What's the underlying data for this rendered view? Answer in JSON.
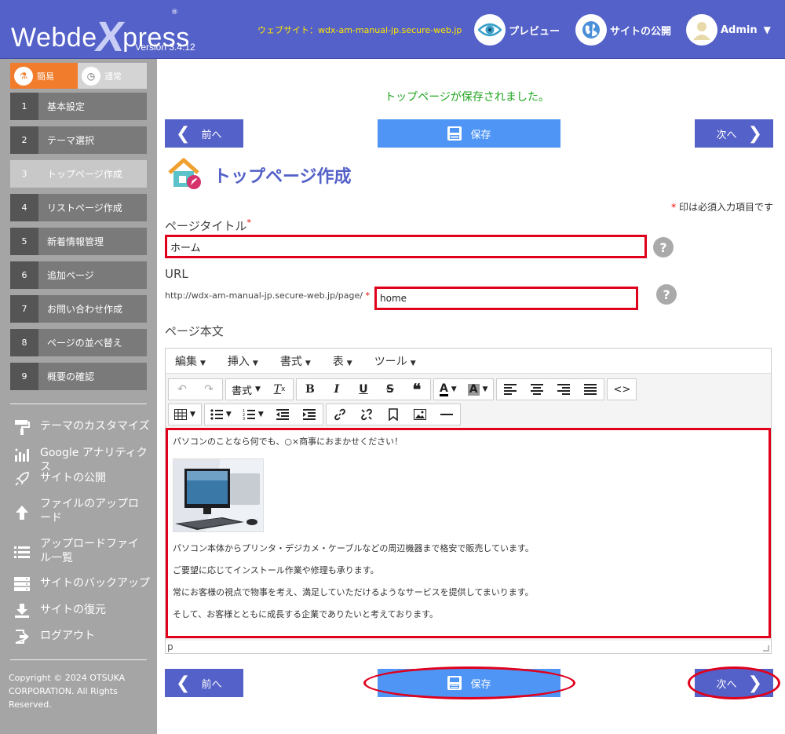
{
  "header": {
    "logo": {
      "part1": "Webde",
      "part2": "X",
      "part3": "press"
    },
    "version": "Version 3.4.12",
    "website": "ウェブサイト：wdx-am-manual-jp.secure-web.jp",
    "preview_label": "プレビュー",
    "publish_label": "サイトの公開",
    "admin_label": "Admin"
  },
  "sidebar": {
    "modes": [
      {
        "label": "簡易"
      },
      {
        "label": "通常"
      }
    ],
    "steps": [
      {
        "num": "1",
        "label": "基本設定"
      },
      {
        "num": "2",
        "label": "テーマ選択"
      },
      {
        "num": "3",
        "label": "トップページ作成"
      },
      {
        "num": "4",
        "label": "リストページ作成"
      },
      {
        "num": "5",
        "label": "新着情報管理"
      },
      {
        "num": "6",
        "label": "追加ページ"
      },
      {
        "num": "7",
        "label": "お問い合わせ作成"
      },
      {
        "num": "8",
        "label": "ページの並べ替え"
      },
      {
        "num": "9",
        "label": "概要の確認"
      }
    ],
    "tools": [
      {
        "label": "テーマのカスタマイズ",
        "icon": "paint-roller-icon"
      },
      {
        "label": "Google アナリティクス",
        "icon": "bar-chart-icon"
      },
      {
        "label": "サイトの公開",
        "icon": "rocket-icon"
      },
      {
        "label": "ファイルのアップロード",
        "icon": "upload-icon"
      },
      {
        "label": "アップロードファイル一覧",
        "icon": "list-icon"
      },
      {
        "label": "サイトのバックアップ",
        "icon": "server-icon"
      },
      {
        "label": "サイトの復元",
        "icon": "download-icon"
      },
      {
        "label": "ログアウト",
        "icon": "logout-icon"
      }
    ],
    "copyright": "Copyright © 2024 OTSUKA CORPORATION. All Rights Reserved."
  },
  "main": {
    "message": "トップページが保存されました。",
    "nav": {
      "prev": "前へ",
      "save": "保存",
      "next": "次へ"
    },
    "page_title": "トップページ作成",
    "required_note": "印は必須入力項目です",
    "required_mark": "*",
    "fields": {
      "page_title_label": "ページタイトル",
      "page_title_value": "ホーム",
      "url_label": "URL",
      "url_prefix": "http://wdx-am-manual-jp.secure-web.jp/page/",
      "url_value": "home",
      "body_label": "ページ本文",
      "help": "?"
    },
    "editor": {
      "menus": [
        "編集",
        "挿入",
        "書式",
        "表",
        "ツール"
      ],
      "format_label": "書式",
      "content": {
        "p1": "パソコンのことなら何でも、○×商事におまかせください！",
        "p2": "パソコン本体からプリンタ・デジカメ・ケーブルなどの周辺機器まで格安で販売しています。",
        "p3": "ご要望に応じてインストール作業や修理も承ります。",
        "p4": "常にお客様の視点で物事を考え、満足していただけるようなサービスを提供してまいります。",
        "p5": "そして、お客様とともに成長する企業でありたいと考えております。"
      },
      "status_path": "p"
    }
  },
  "colors": {
    "brand": "#5461c8",
    "accent_orange": "#f07c2c",
    "save_blue": "#4f95f5",
    "highlight_red": "#e0001b",
    "success_green": "#1fa51f"
  }
}
